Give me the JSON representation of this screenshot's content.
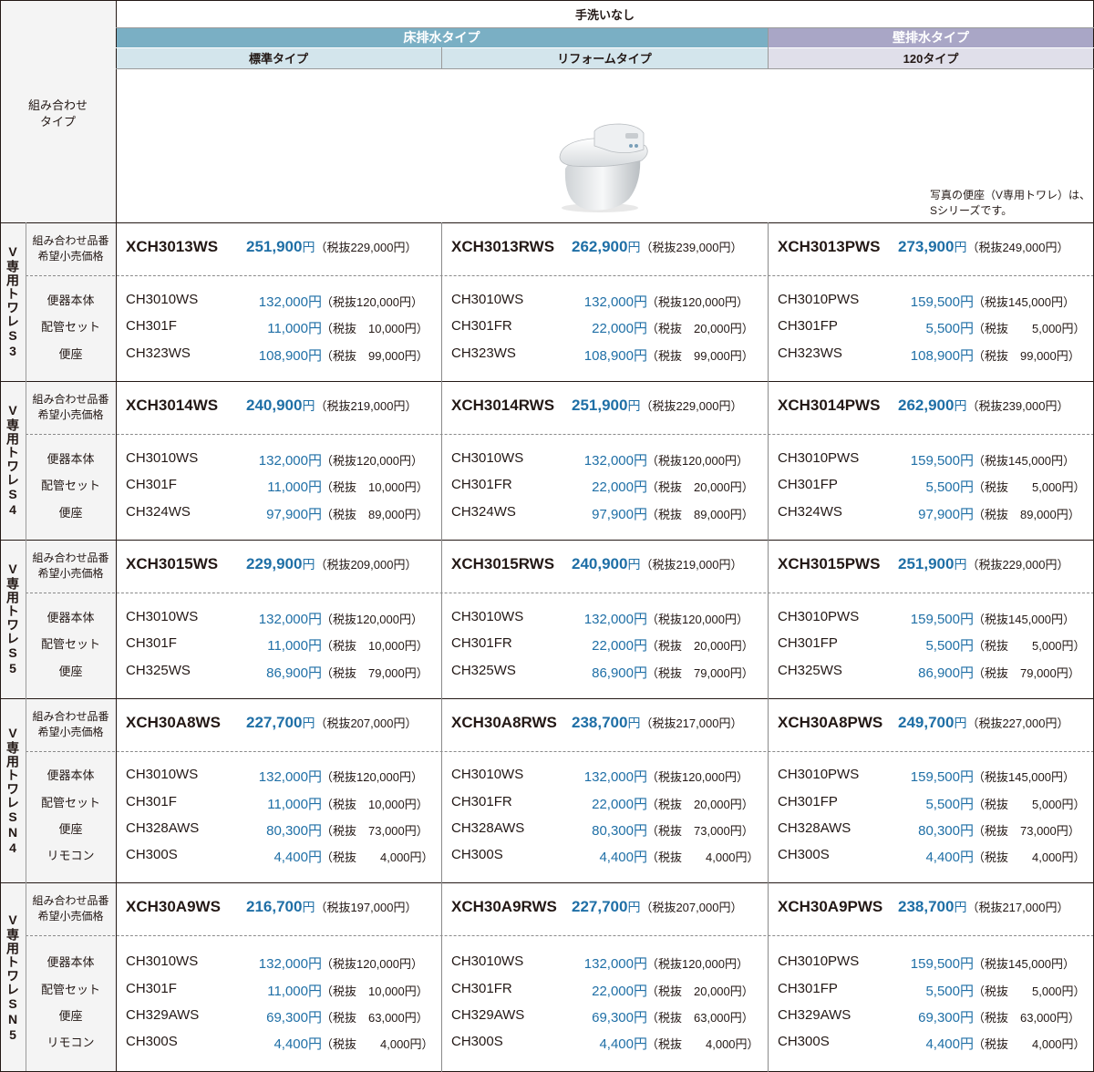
{
  "header": {
    "top": "手洗いなし",
    "group_floor": "床排水タイプ",
    "group_wall": "壁排水タイプ",
    "sub_standard": "標準タイプ",
    "sub_reform": "リフォームタイプ",
    "sub_120": "120タイプ",
    "combo_type_label": "組み合わせ\nタイプ",
    "photo_note": "写真の便座（V専用トワレ）は、\nSシリーズです。"
  },
  "colors": {
    "floor_header": "#7aafc4",
    "wall_header": "#a9a6c6",
    "floor_sub": "#d3e5ec",
    "wall_sub": "#e0dfea",
    "left_col": "#f4f4f4",
    "price_blue": "#1f6fa6"
  },
  "labels": {
    "combo": "組み合わせ品番\n希望小売価格",
    "body": "便器本体",
    "pipe": "配管セット",
    "seat": "便座",
    "remote": "リモコン"
  },
  "blocks": [
    {
      "name": "V専用トワレS3",
      "combos": [
        {
          "code": "XCH3013WS",
          "price": "251,900",
          "yen": "円",
          "tax": "（税抜229,000円）"
        },
        {
          "code": "XCH3013RWS",
          "price": "262,900",
          "yen": "円",
          "tax": "（税抜239,000円）"
        },
        {
          "code": "XCH3013PWS",
          "price": "273,900",
          "yen": "円",
          "tax": "（税抜249,000円）"
        }
      ],
      "items": [
        {
          "label": "便器本体",
          "cols": [
            {
              "code": "CH3010WS",
              "price": "132,000円",
              "tax": "（税抜120,000円）"
            },
            {
              "code": "CH3010WS",
              "price": "132,000円",
              "tax": "（税抜120,000円）"
            },
            {
              "code": "CH3010PWS",
              "price": "159,500円",
              "tax": "（税抜145,000円）"
            }
          ]
        },
        {
          "label": "配管セット",
          "cols": [
            {
              "code": "CH301F",
              "price": "11,000円",
              "tax": "（税抜　10,000円）"
            },
            {
              "code": "CH301FR",
              "price": "22,000円",
              "tax": "（税抜　20,000円）"
            },
            {
              "code": "CH301FP",
              "price": "5,500円",
              "tax": "（税抜　　5,000円）"
            }
          ]
        },
        {
          "label": "便座",
          "cols": [
            {
              "code": "CH323WS",
              "price": "108,900円",
              "tax": "（税抜　99,000円）"
            },
            {
              "code": "CH323WS",
              "price": "108,900円",
              "tax": "（税抜　99,000円）"
            },
            {
              "code": "CH323WS",
              "price": "108,900円",
              "tax": "（税抜　99,000円）"
            }
          ]
        }
      ]
    },
    {
      "name": "V専用トワレS4",
      "combos": [
        {
          "code": "XCH3014WS",
          "price": "240,900",
          "yen": "円",
          "tax": "（税抜219,000円）"
        },
        {
          "code": "XCH3014RWS",
          "price": "251,900",
          "yen": "円",
          "tax": "（税抜229,000円）"
        },
        {
          "code": "XCH3014PWS",
          "price": "262,900",
          "yen": "円",
          "tax": "（税抜239,000円）"
        }
      ],
      "items": [
        {
          "label": "便器本体",
          "cols": [
            {
              "code": "CH3010WS",
              "price": "132,000円",
              "tax": "（税抜120,000円）"
            },
            {
              "code": "CH3010WS",
              "price": "132,000円",
              "tax": "（税抜120,000円）"
            },
            {
              "code": "CH3010PWS",
              "price": "159,500円",
              "tax": "（税抜145,000円）"
            }
          ]
        },
        {
          "label": "配管セット",
          "cols": [
            {
              "code": "CH301F",
              "price": "11,000円",
              "tax": "（税抜　10,000円）"
            },
            {
              "code": "CH301FR",
              "price": "22,000円",
              "tax": "（税抜　20,000円）"
            },
            {
              "code": "CH301FP",
              "price": "5,500円",
              "tax": "（税抜　　5,000円）"
            }
          ]
        },
        {
          "label": "便座",
          "cols": [
            {
              "code": "CH324WS",
              "price": "97,900円",
              "tax": "（税抜　89,000円）"
            },
            {
              "code": "CH324WS",
              "price": "97,900円",
              "tax": "（税抜　89,000円）"
            },
            {
              "code": "CH324WS",
              "price": "97,900円",
              "tax": "（税抜　89,000円）"
            }
          ]
        }
      ]
    },
    {
      "name": "V専用トワレS5",
      "combos": [
        {
          "code": "XCH3015WS",
          "price": "229,900",
          "yen": "円",
          "tax": "（税抜209,000円）"
        },
        {
          "code": "XCH3015RWS",
          "price": "240,900",
          "yen": "円",
          "tax": "（税抜219,000円）"
        },
        {
          "code": "XCH3015PWS",
          "price": "251,900",
          "yen": "円",
          "tax": "（税抜229,000円）"
        }
      ],
      "items": [
        {
          "label": "便器本体",
          "cols": [
            {
              "code": "CH3010WS",
              "price": "132,000円",
              "tax": "（税抜120,000円）"
            },
            {
              "code": "CH3010WS",
              "price": "132,000円",
              "tax": "（税抜120,000円）"
            },
            {
              "code": "CH3010PWS",
              "price": "159,500円",
              "tax": "（税抜145,000円）"
            }
          ]
        },
        {
          "label": "配管セット",
          "cols": [
            {
              "code": "CH301F",
              "price": "11,000円",
              "tax": "（税抜　10,000円）"
            },
            {
              "code": "CH301FR",
              "price": "22,000円",
              "tax": "（税抜　20,000円）"
            },
            {
              "code": "CH301FP",
              "price": "5,500円",
              "tax": "（税抜　　5,000円）"
            }
          ]
        },
        {
          "label": "便座",
          "cols": [
            {
              "code": "CH325WS",
              "price": "86,900円",
              "tax": "（税抜　79,000円）"
            },
            {
              "code": "CH325WS",
              "price": "86,900円",
              "tax": "（税抜　79,000円）"
            },
            {
              "code": "CH325WS",
              "price": "86,900円",
              "tax": "（税抜　79,000円）"
            }
          ]
        }
      ]
    },
    {
      "name": "V専用トワレSN4",
      "combos": [
        {
          "code": "XCH30A8WS",
          "price": "227,700",
          "yen": "円",
          "tax": "（税抜207,000円）"
        },
        {
          "code": "XCH30A8RWS",
          "price": "238,700",
          "yen": "円",
          "tax": "（税抜217,000円）"
        },
        {
          "code": "XCH30A8PWS",
          "price": "249,700",
          "yen": "円",
          "tax": "（税抜227,000円）"
        }
      ],
      "items": [
        {
          "label": "便器本体",
          "cols": [
            {
              "code": "CH3010WS",
              "price": "132,000円",
              "tax": "（税抜120,000円）"
            },
            {
              "code": "CH3010WS",
              "price": "132,000円",
              "tax": "（税抜120,000円）"
            },
            {
              "code": "CH3010PWS",
              "price": "159,500円",
              "tax": "（税抜145,000円）"
            }
          ]
        },
        {
          "label": "配管セット",
          "cols": [
            {
              "code": "CH301F",
              "price": "11,000円",
              "tax": "（税抜　10,000円）"
            },
            {
              "code": "CH301FR",
              "price": "22,000円",
              "tax": "（税抜　20,000円）"
            },
            {
              "code": "CH301FP",
              "price": "5,500円",
              "tax": "（税抜　　5,000円）"
            }
          ]
        },
        {
          "label": "便座",
          "cols": [
            {
              "code": "CH328AWS",
              "price": "80,300円",
              "tax": "（税抜　73,000円）"
            },
            {
              "code": "CH328AWS",
              "price": "80,300円",
              "tax": "（税抜　73,000円）"
            },
            {
              "code": "CH328AWS",
              "price": "80,300円",
              "tax": "（税抜　73,000円）"
            }
          ]
        },
        {
          "label": "リモコン",
          "cols": [
            {
              "code": "CH300S",
              "price": "4,400円",
              "tax": "（税抜　　4,000円）"
            },
            {
              "code": "CH300S",
              "price": "4,400円",
              "tax": "（税抜　　4,000円）"
            },
            {
              "code": "CH300S",
              "price": "4,400円",
              "tax": "（税抜　　4,000円）"
            }
          ]
        }
      ]
    },
    {
      "name": "V専用トワレSN5",
      "combos": [
        {
          "code": "XCH30A9WS",
          "price": "216,700",
          "yen": "円",
          "tax": "（税抜197,000円）"
        },
        {
          "code": "XCH30A9RWS",
          "price": "227,700",
          "yen": "円",
          "tax": "（税抜207,000円）"
        },
        {
          "code": "XCH30A9PWS",
          "price": "238,700",
          "yen": "円",
          "tax": "（税抜217,000円）"
        }
      ],
      "items": [
        {
          "label": "便器本体",
          "cols": [
            {
              "code": "CH3010WS",
              "price": "132,000円",
              "tax": "（税抜120,000円）"
            },
            {
              "code": "CH3010WS",
              "price": "132,000円",
              "tax": "（税抜120,000円）"
            },
            {
              "code": "CH3010PWS",
              "price": "159,500円",
              "tax": "（税抜145,000円）"
            }
          ]
        },
        {
          "label": "配管セット",
          "cols": [
            {
              "code": "CH301F",
              "price": "11,000円",
              "tax": "（税抜　10,000円）"
            },
            {
              "code": "CH301FR",
              "price": "22,000円",
              "tax": "（税抜　20,000円）"
            },
            {
              "code": "CH301FP",
              "price": "5,500円",
              "tax": "（税抜　　5,000円）"
            }
          ]
        },
        {
          "label": "便座",
          "cols": [
            {
              "code": "CH329AWS",
              "price": "69,300円",
              "tax": "（税抜　63,000円）"
            },
            {
              "code": "CH329AWS",
              "price": "69,300円",
              "tax": "（税抜　63,000円）"
            },
            {
              "code": "CH329AWS",
              "price": "69,300円",
              "tax": "（税抜　63,000円）"
            }
          ]
        },
        {
          "label": "リモコン",
          "cols": [
            {
              "code": "CH300S",
              "price": "4,400円",
              "tax": "（税抜　　4,000円）"
            },
            {
              "code": "CH300S",
              "price": "4,400円",
              "tax": "（税抜　　4,000円）"
            },
            {
              "code": "CH300S",
              "price": "4,400円",
              "tax": "（税抜　　4,000円）"
            }
          ]
        }
      ]
    }
  ]
}
